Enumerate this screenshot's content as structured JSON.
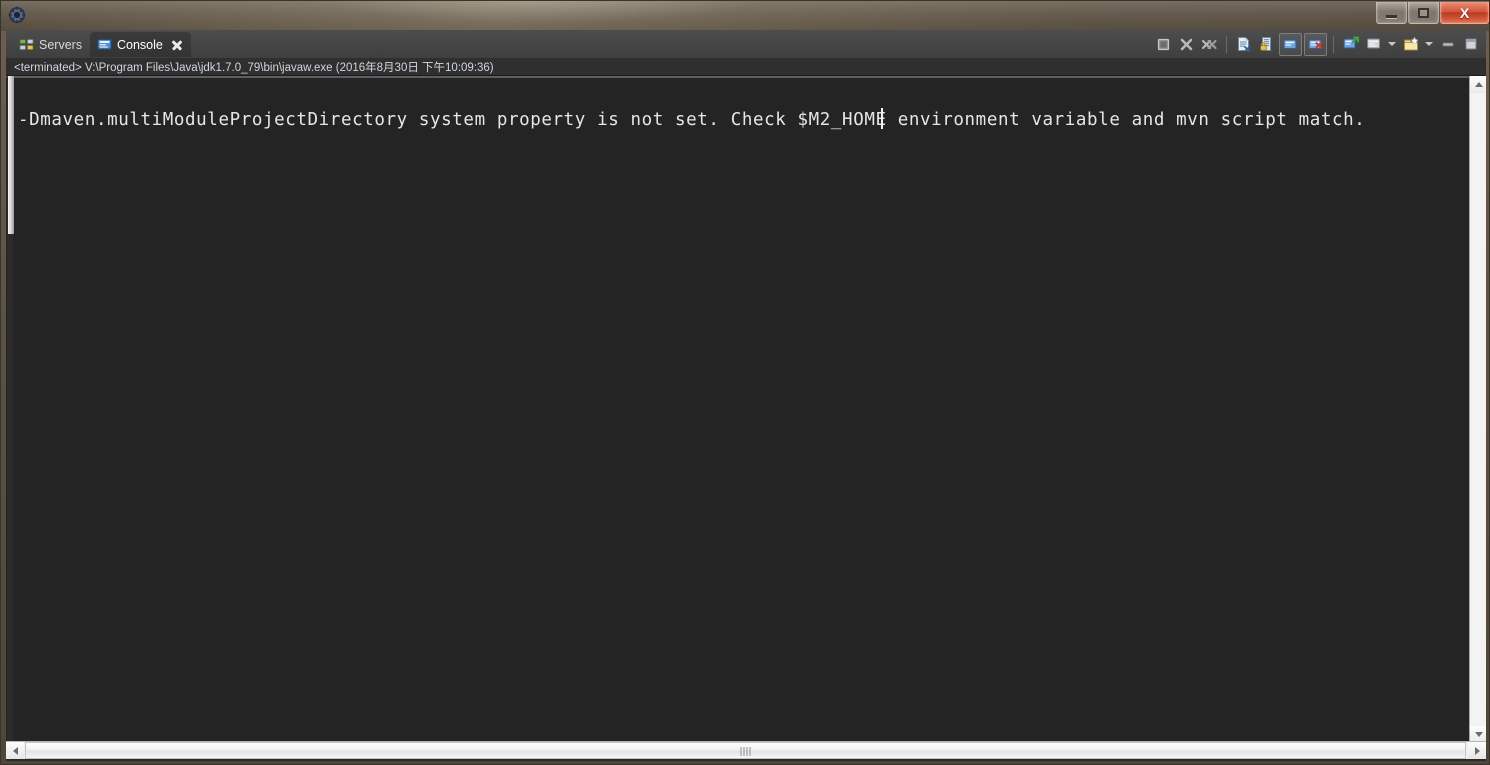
{
  "window": {
    "title": "",
    "icon": "eclipse-gear-icon",
    "controls": {
      "minimize_label": "Minimize",
      "maximize_label": "Restore",
      "close_label": "Close",
      "close_glyph": "X"
    },
    "frame_color": "#5d5244"
  },
  "tabs": [
    {
      "id": "servers",
      "label": "Servers",
      "icon": "servers-icon",
      "active": false,
      "closable": false
    },
    {
      "id": "console",
      "label": "Console",
      "icon": "console-monitor-icon",
      "active": true,
      "closable": true
    }
  ],
  "toolbar": {
    "buttons": [
      {
        "id": "terminate",
        "name": "terminate-button",
        "icon": "stop-square-icon",
        "tooltip": "Terminate",
        "framed": false
      },
      {
        "id": "remove-launch",
        "name": "remove-launch-button",
        "icon": "remove-x-icon",
        "tooltip": "Remove Launch",
        "framed": false
      },
      {
        "id": "remove-all",
        "name": "remove-all-terminated-button",
        "icon": "remove-all-x-icon",
        "tooltip": "Remove All Terminated Launches",
        "framed": false
      },
      {
        "id": "clear",
        "name": "clear-console-button",
        "icon": "clear-console-icon",
        "tooltip": "Clear Console",
        "framed": false
      },
      {
        "id": "scroll-lock",
        "name": "scroll-lock-button",
        "icon": "scroll-lock-icon",
        "tooltip": "Scroll Lock",
        "framed": false
      },
      {
        "id": "pin-console",
        "name": "pin-console-button",
        "icon": "pin-console-icon",
        "tooltip": "Pin Console",
        "framed": true
      },
      {
        "id": "display-console",
        "name": "display-selected-console-button",
        "icon": "display-console-icon",
        "tooltip": "Display Selected Console",
        "framed": true
      },
      {
        "id": "open-console",
        "name": "open-console-button",
        "icon": "open-console-icon",
        "tooltip": "Open Console",
        "framed": false
      },
      {
        "id": "new-console-view",
        "name": "new-console-view-button",
        "icon": "new-console-view-icon",
        "tooltip": "New Console View",
        "framed": false
      },
      {
        "id": "view-menu",
        "name": "view-menu-button",
        "icon": "view-menu-icon",
        "tooltip": "View Menu",
        "framed": false
      },
      {
        "id": "minimize-view",
        "name": "minimize-view-button",
        "icon": "minimize-view-icon",
        "tooltip": "Minimize",
        "framed": false
      },
      {
        "id": "maximize-view",
        "name": "maximize-view-button",
        "icon": "maximize-view-icon",
        "tooltip": "Maximize",
        "framed": false
      }
    ]
  },
  "console": {
    "header": "<terminated> V:\\Program Files\\Java\\jdk1.7.0_79\\bin\\javaw.exe (2016年8月30日 下午10:09:36)",
    "status": "terminated",
    "executable_path": "V:\\Program Files\\Java\\jdk1.7.0_79\\bin\\javaw.exe",
    "timestamp": "2016年8月30日 下午10:09:36",
    "output": "-Dmaven.multiModuleProjectDirectory system property is not set. Check $M2_HOME environment variable and mvn script match.",
    "background": "#242424",
    "text_color": "#e6e6e6"
  },
  "scrollbars": {
    "vertical": {
      "up_glyph": "▲",
      "down_glyph": "▼"
    },
    "horizontal": {
      "left_glyph": "◀",
      "right_glyph": "▶"
    }
  }
}
